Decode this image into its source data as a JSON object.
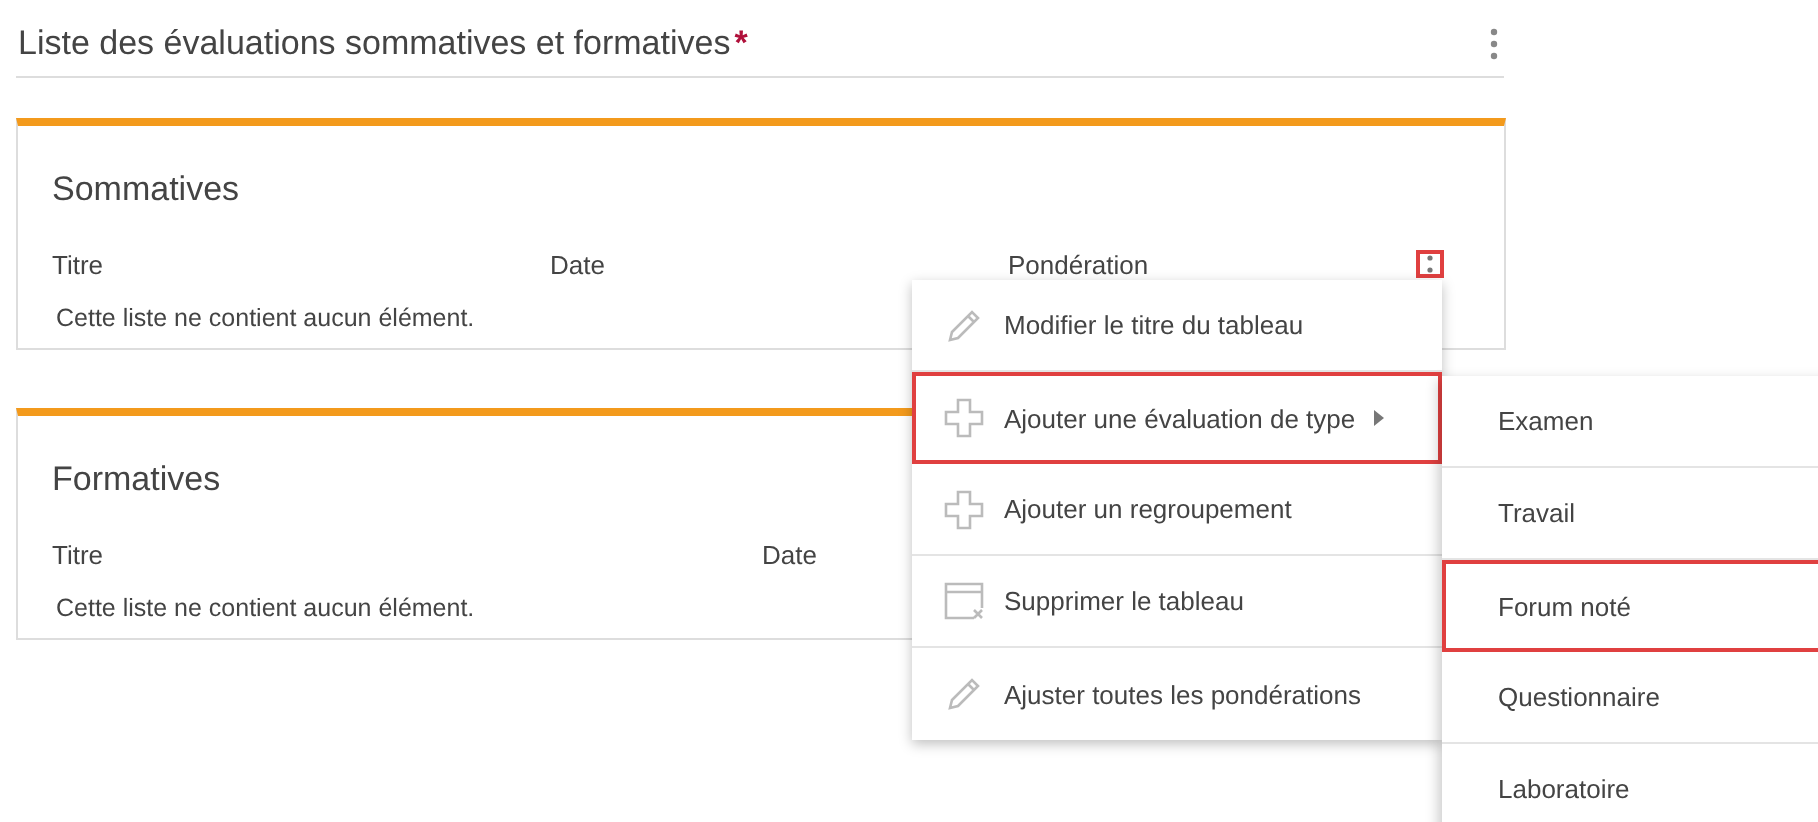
{
  "header": {
    "title": "Liste des évaluations sommatives et formatives",
    "required_mark": "*"
  },
  "sections": [
    {
      "title": "Sommatives",
      "columns": [
        "Titre",
        "Date",
        "Pondération"
      ],
      "empty_text": "Cette liste ne contient aucun élément.",
      "menu_button": {
        "highlighted": true
      }
    },
    {
      "title": "Formatives",
      "columns": [
        "Titre",
        "Date"
      ],
      "empty_text": "Cette liste ne contient aucun élément."
    }
  ],
  "context_menu": {
    "items": [
      {
        "label": "Modifier le titre du tableau",
        "kind": "pencil",
        "has_submenu": false,
        "highlighted": false
      },
      {
        "label": "Ajouter une évaluation de type",
        "kind": "plus",
        "has_submenu": true,
        "highlighted": true
      },
      {
        "label": "Ajouter un regroupement",
        "kind": "plus",
        "has_submenu": false,
        "highlighted": false
      },
      {
        "label": "Supprimer le tableau",
        "kind": "table",
        "has_submenu": false,
        "highlighted": false
      },
      {
        "label": "Ajuster toutes les pondérations",
        "kind": "pencil",
        "has_submenu": false,
        "highlighted": false
      }
    ]
  },
  "submenu": {
    "items": [
      {
        "label": "Examen",
        "highlighted": false
      },
      {
        "label": "Travail",
        "highlighted": false
      },
      {
        "label": "Forum noté",
        "highlighted": true
      },
      {
        "label": "Questionnaire",
        "highlighted": false
      },
      {
        "label": "Laboratoire",
        "highlighted": false
      }
    ]
  }
}
